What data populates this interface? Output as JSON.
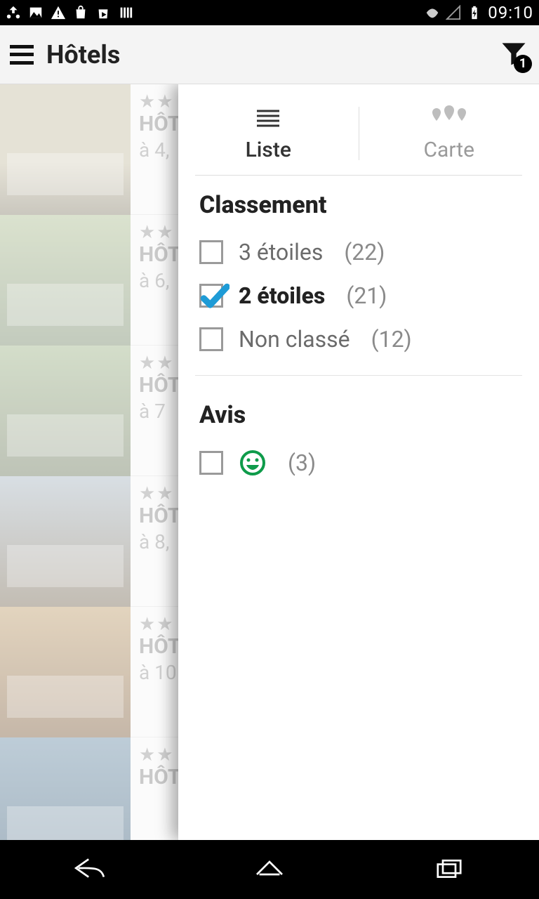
{
  "statusbar": {
    "time": "09:10"
  },
  "appbar": {
    "title": "Hôtels",
    "filter_badge": "1"
  },
  "tabs": {
    "liste": "Liste",
    "carte": "Carte"
  },
  "sections": {
    "classement": {
      "title": "Classement",
      "options": [
        {
          "label": "3 étoiles",
          "count": "(22)",
          "checked": false
        },
        {
          "label": "2 étoiles",
          "count": "(21)",
          "checked": true
        },
        {
          "label": "Non classé",
          "count": "(12)",
          "checked": false
        }
      ]
    },
    "avis": {
      "title": "Avis",
      "options": [
        {
          "label_icon": "smiley",
          "count": "(3)",
          "checked": false
        }
      ]
    }
  },
  "hotels": [
    {
      "stars": "★★",
      "name": "HÔT QU",
      "dist": "à 4,"
    },
    {
      "stars": "★★",
      "name": "HÔT FAL",
      "dist": "à 6,"
    },
    {
      "stars": "★★",
      "name": "HÔT BO",
      "dist": "à 7"
    },
    {
      "stars": "★★",
      "name": "HÔT FÉN",
      "dist": "à 8,"
    },
    {
      "stars": "★★",
      "name": "HÔT AU",
      "dist": "à 10"
    },
    {
      "stars": "★★",
      "name": "HÔT GR",
      "dist": ""
    }
  ]
}
